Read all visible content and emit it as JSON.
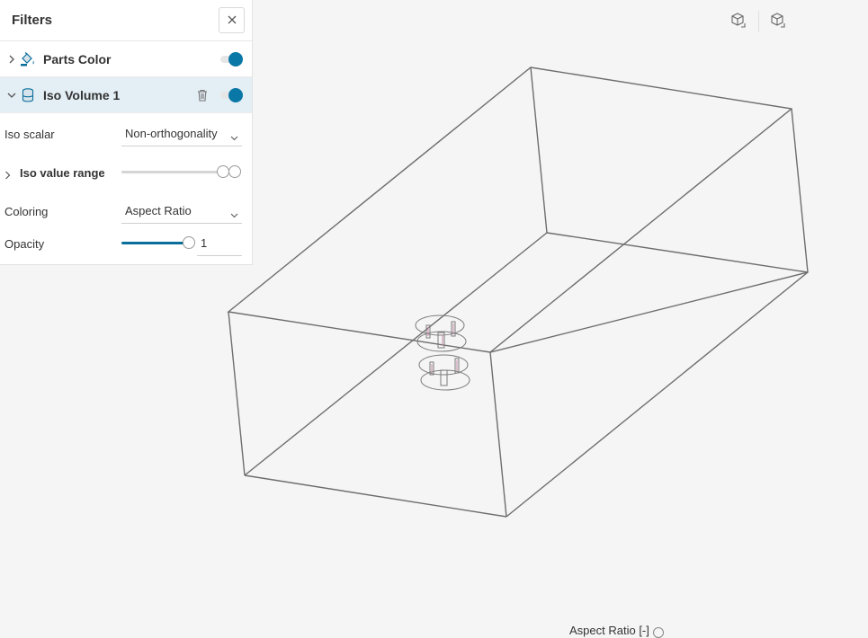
{
  "panel": {
    "title": "Filters"
  },
  "filters": [
    {
      "name": "Parts Color",
      "enabled": true,
      "icon": "paint-bucket-icon",
      "expanded": false
    },
    {
      "name": "Iso Volume 1",
      "enabled": true,
      "icon": "cylinder-icon",
      "expanded": true
    }
  ],
  "iso_volume": {
    "iso_scalar_label": "Iso scalar",
    "iso_scalar_value": "Non-orthogonality",
    "iso_value_range_label": "Iso value range",
    "iso_value_range": {
      "low": 0.9,
      "high": 1.0
    },
    "coloring_label": "Coloring",
    "coloring_value": "Aspect Ratio",
    "opacity_label": "Opacity",
    "opacity_value": "1",
    "opacity_fraction": 1.0
  },
  "toolbar": {
    "icons": [
      "cube-view-icon",
      "cube-view-icon"
    ]
  },
  "legend": {
    "title": "Aspect Ratio [-]"
  },
  "colors": {
    "accent": "#0a78a6",
    "selected_row": "#e3eef5",
    "background": "#f5f5f5",
    "wireframe": "#6e6e6e"
  }
}
